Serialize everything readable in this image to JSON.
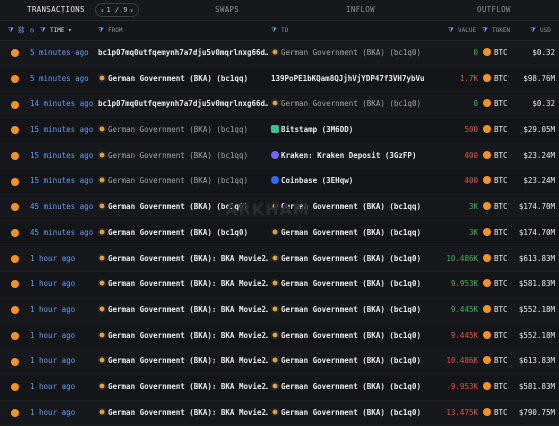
{
  "tabs": {
    "transactions": "TRANSACTIONS",
    "pager": "1 / 9",
    "swaps": "SWAPS",
    "inflow": "INFLOW",
    "outflow": "OUTFLOW"
  },
  "columns": {
    "time": "TIME",
    "from": "FROM",
    "to": "TO",
    "value": "VALUE",
    "token": "TOKEN",
    "usd": "USD"
  },
  "watermark": "ARKHAM",
  "colors": {
    "accent": "#5f9ff0",
    "inflow": "#3fb950",
    "outflow": "#e5534b",
    "btc": "#f7931a"
  },
  "rows": [
    {
      "time": "5 minutes ago",
      "from_name": "bc1p07mq0utfqemynh7a7dju5v0mqrlnxg66d…",
      "from_tag": "",
      "to_name": "German Government (BKA)",
      "to_tag": "(bc1q0)",
      "value": "0",
      "dir": "in",
      "token": "BTC",
      "usd": "$0.32",
      "to_icon": "ent",
      "to_dim": true,
      "from_dim": false,
      "from_icon": ""
    },
    {
      "time": "5 minutes ago",
      "from_name": "German Government (BKA)",
      "from_tag": "(bc1qq)",
      "to_name": "139PoPE1bKQam8QJjhVjYDP47f3VH7ybVu",
      "to_tag": "",
      "value": "1.7K",
      "dir": "out",
      "token": "BTC",
      "usd": "$98.76M",
      "to_icon": "",
      "to_dim": false,
      "from_dim": false,
      "from_icon": "ent"
    },
    {
      "time": "14 minutes ago",
      "from_name": "bc1p07mq0utfqemynh7a7dju5v0mqrlnxg66d…",
      "from_tag": "",
      "to_name": "German Government (BKA)",
      "to_tag": "(bc1q0)",
      "value": "0",
      "dir": "in",
      "token": "BTC",
      "usd": "$0.32",
      "to_icon": "ent",
      "to_dim": true,
      "from_dim": false,
      "from_icon": ""
    },
    {
      "time": "15 minutes ago",
      "from_name": "German Government (BKA)",
      "from_tag": "(bc1qq)",
      "to_name": "Bitstamp",
      "to_tag": "(3M6DD)",
      "value": "500",
      "dir": "out",
      "token": "BTC",
      "usd": "$29.05M",
      "to_icon": "bit",
      "to_dim": false,
      "from_dim": true,
      "from_icon": "ent"
    },
    {
      "time": "15 minutes ago",
      "from_name": "German Government (BKA)",
      "from_tag": "(bc1qq)",
      "to_name": "Kraken: Kraken Deposit",
      "to_tag": "(3GzFP)",
      "value": "400",
      "dir": "out",
      "token": "BTC",
      "usd": "$23.24M",
      "to_icon": "kra",
      "to_dim": false,
      "from_dim": true,
      "from_icon": "ent"
    },
    {
      "time": "15 minutes ago",
      "from_name": "German Government (BKA)",
      "from_tag": "(bc1qq)",
      "to_name": "Coinbase",
      "to_tag": "(3EHqw)",
      "value": "400",
      "dir": "out",
      "token": "BTC",
      "usd": "$23.24M",
      "to_icon": "coin",
      "to_dim": false,
      "from_dim": true,
      "from_icon": "ent"
    },
    {
      "time": "45 minutes ago",
      "from_name": "German Government (BKA)",
      "from_tag": "(bc1q0)",
      "to_name": "German Government (BKA)",
      "to_tag": "(bc1qq)",
      "value": "3K",
      "dir": "in",
      "token": "BTC",
      "usd": "$174.70M",
      "to_icon": "ent",
      "to_dim": false,
      "from_dim": false,
      "from_icon": "ent"
    },
    {
      "time": "45 minutes ago",
      "from_name": "German Government (BKA)",
      "from_tag": "(bc1q0)",
      "to_name": "German Government (BKA)",
      "to_tag": "(bc1qq)",
      "value": "3K",
      "dir": "in",
      "token": "BTC",
      "usd": "$174.70M",
      "to_icon": "ent",
      "to_dim": false,
      "from_dim": false,
      "from_icon": "ent"
    },
    {
      "time": "1 hour ago",
      "from_name": "German Government (BKA): BKA Movie2…",
      "from_tag": "",
      "to_name": "German Government (BKA)",
      "to_tag": "(bc1q0)",
      "value": "10.486K",
      "dir": "in",
      "token": "BTC",
      "usd": "$613.83M",
      "to_icon": "ent",
      "to_dim": false,
      "from_dim": false,
      "from_icon": "ent"
    },
    {
      "time": "1 hour ago",
      "from_name": "German Government (BKA): BKA Movie2…",
      "from_tag": "",
      "to_name": "German Government (BKA)",
      "to_tag": "(bc1q0)",
      "value": "9.953K",
      "dir": "in",
      "token": "BTC",
      "usd": "$581.83M",
      "to_icon": "ent",
      "to_dim": false,
      "from_dim": false,
      "from_icon": "ent"
    },
    {
      "time": "1 hour ago",
      "from_name": "German Government (BKA): BKA Movie2…",
      "from_tag": "",
      "to_name": "German Government (BKA)",
      "to_tag": "(bc1q0)",
      "value": "9.445K",
      "dir": "in",
      "token": "BTC",
      "usd": "$552.18M",
      "to_icon": "ent",
      "to_dim": false,
      "from_dim": false,
      "from_icon": "ent"
    },
    {
      "time": "1 hour ago",
      "from_name": "German Government (BKA): BKA Movie2…",
      "from_tag": "",
      "to_name": "German Government (BKA)",
      "to_tag": "(bc1q0)",
      "value": "9.445K",
      "dir": "out",
      "token": "BTC",
      "usd": "$552.18M",
      "to_icon": "ent",
      "to_dim": false,
      "from_dim": false,
      "from_icon": "ent"
    },
    {
      "time": "1 hour ago",
      "from_name": "German Government (BKA): BKA Movie2…",
      "from_tag": "",
      "to_name": "German Government (BKA)",
      "to_tag": "(bc1q0)",
      "value": "10.486K",
      "dir": "out",
      "token": "BTC",
      "usd": "$613.83M",
      "to_icon": "ent",
      "to_dim": false,
      "from_dim": false,
      "from_icon": "ent"
    },
    {
      "time": "1 hour ago",
      "from_name": "German Government (BKA): BKA Movie2…",
      "from_tag": "",
      "to_name": "German Government (BKA)",
      "to_tag": "(bc1q0)",
      "value": "9.953K",
      "dir": "out",
      "token": "BTC",
      "usd": "$581.83M",
      "to_icon": "ent",
      "to_dim": false,
      "from_dim": false,
      "from_icon": "ent"
    },
    {
      "time": "1 hour ago",
      "from_name": "German Government (BKA): BKA Movie2…",
      "from_tag": "",
      "to_name": "German Government (BKA)",
      "to_tag": "(bc1q0)",
      "value": "13.475K",
      "dir": "out",
      "token": "BTC",
      "usd": "$790.75M",
      "to_icon": "ent",
      "to_dim": false,
      "from_dim": false,
      "from_icon": "ent"
    }
  ]
}
